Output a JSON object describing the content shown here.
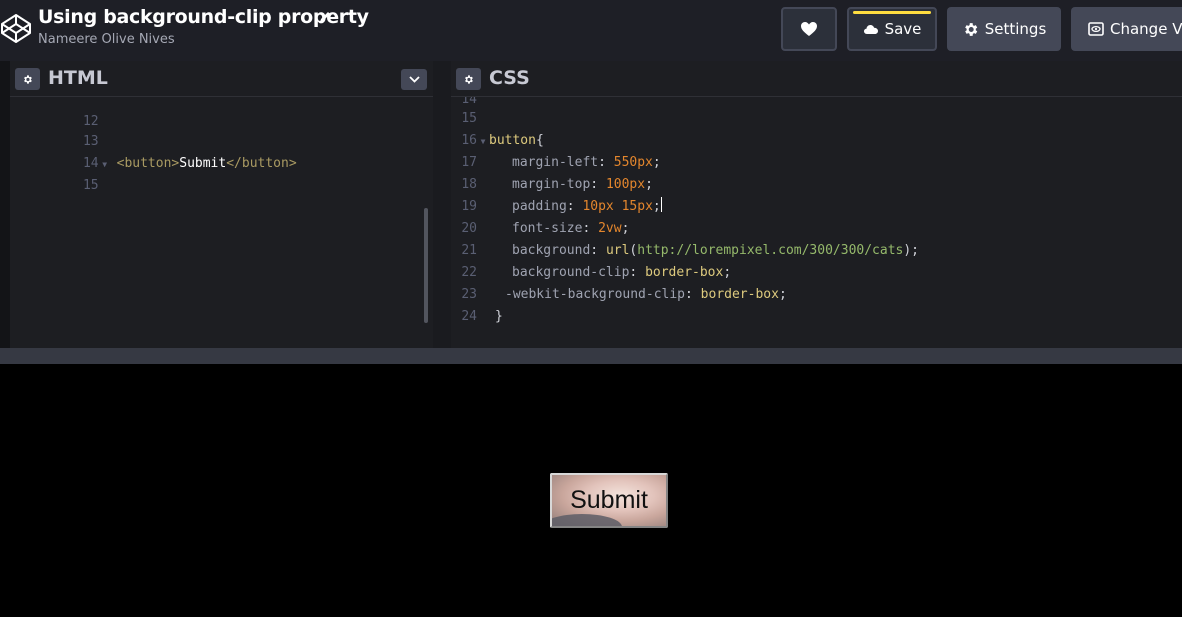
{
  "header": {
    "title": "Using background-clip property",
    "author": "Nameere Olive Nives",
    "save_label": "Save",
    "settings_label": "Settings",
    "change_view_label": "Change View"
  },
  "html_pane": {
    "title": "HTML",
    "lines": [
      {
        "num": "12",
        "text": ""
      },
      {
        "num": "13",
        "text": ""
      },
      {
        "num": "14",
        "open": "<button>",
        "content": "Submit",
        "close": "</button>"
      },
      {
        "num": "15",
        "text": ""
      }
    ]
  },
  "css_pane": {
    "title": "CSS",
    "lines": [
      {
        "num": "14"
      },
      {
        "num": "15"
      },
      {
        "num": "16",
        "selector": "button",
        "brace": "{"
      },
      {
        "num": "17",
        "prop": "margin-left",
        "value": "550px"
      },
      {
        "num": "18",
        "prop": "margin-top",
        "value": "100px"
      },
      {
        "num": "19",
        "prop": "padding",
        "value": "10px 15px"
      },
      {
        "num": "20",
        "prop": "font-size",
        "value": "2vw"
      },
      {
        "num": "21",
        "prop": "background",
        "fn": "url",
        "url": "http://lorempixel.com/300/300/cats"
      },
      {
        "num": "22",
        "prop": "background-clip",
        "keyword": "border-box"
      },
      {
        "num": "23",
        "prop": "-webkit-background-clip",
        "keyword": "border-box"
      },
      {
        "num": "24",
        "brace": "}"
      }
    ]
  },
  "preview": {
    "button_label": "Submit"
  },
  "colors": {
    "accent_yellow": "#ffdd40",
    "header_bg": "#1e1f26",
    "editor_bg": "#1d1e22"
  }
}
